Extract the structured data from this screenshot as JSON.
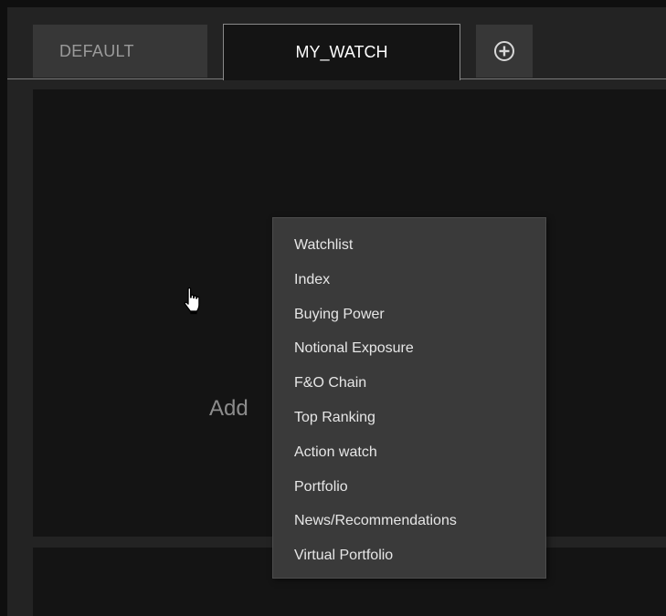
{
  "tabs": [
    {
      "label": "DEFAULT",
      "active": false
    },
    {
      "label": "MY_WATCH",
      "active": true
    }
  ],
  "add_tab_icon": "plus-circle-icon",
  "main": {
    "placeholder_text": "Add"
  },
  "menu": {
    "items": [
      {
        "label": "Watchlist"
      },
      {
        "label": "Index"
      },
      {
        "label": "Buying Power"
      },
      {
        "label": "Notional Exposure"
      },
      {
        "label": "F&O Chain"
      },
      {
        "label": "Top Ranking"
      },
      {
        "label": "Action watch"
      },
      {
        "label": "Portfolio"
      },
      {
        "label": "News/Recommendations"
      },
      {
        "label": "Virtual Portfolio"
      }
    ]
  },
  "cursor_icon": "hand-pointer-icon",
  "colors": {
    "background": "#232323",
    "panel": "#141414",
    "tab_inactive": "#373737",
    "menu_bg": "#3a3a3a",
    "menu_text": "#e6e6e6"
  }
}
